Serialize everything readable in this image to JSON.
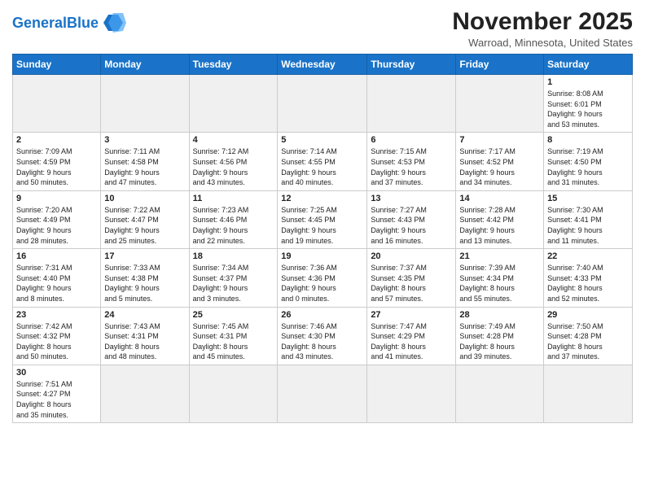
{
  "header": {
    "logo_general": "General",
    "logo_blue": "Blue",
    "month_year": "November 2025",
    "location": "Warroad, Minnesota, United States"
  },
  "days_of_week": [
    "Sunday",
    "Monday",
    "Tuesday",
    "Wednesday",
    "Thursday",
    "Friday",
    "Saturday"
  ],
  "weeks": [
    [
      {
        "day": "",
        "info": "",
        "empty": true
      },
      {
        "day": "",
        "info": "",
        "empty": true
      },
      {
        "day": "",
        "info": "",
        "empty": true
      },
      {
        "day": "",
        "info": "",
        "empty": true
      },
      {
        "day": "",
        "info": "",
        "empty": true
      },
      {
        "day": "",
        "info": "",
        "empty": true
      },
      {
        "day": "1",
        "info": "Sunrise: 8:08 AM\nSunset: 6:01 PM\nDaylight: 9 hours\nand 53 minutes."
      }
    ],
    [
      {
        "day": "2",
        "info": "Sunrise: 7:09 AM\nSunset: 4:59 PM\nDaylight: 9 hours\nand 50 minutes."
      },
      {
        "day": "3",
        "info": "Sunrise: 7:11 AM\nSunset: 4:58 PM\nDaylight: 9 hours\nand 47 minutes."
      },
      {
        "day": "4",
        "info": "Sunrise: 7:12 AM\nSunset: 4:56 PM\nDaylight: 9 hours\nand 43 minutes."
      },
      {
        "day": "5",
        "info": "Sunrise: 7:14 AM\nSunset: 4:55 PM\nDaylight: 9 hours\nand 40 minutes."
      },
      {
        "day": "6",
        "info": "Sunrise: 7:15 AM\nSunset: 4:53 PM\nDaylight: 9 hours\nand 37 minutes."
      },
      {
        "day": "7",
        "info": "Sunrise: 7:17 AM\nSunset: 4:52 PM\nDaylight: 9 hours\nand 34 minutes."
      },
      {
        "day": "8",
        "info": "Sunrise: 7:19 AM\nSunset: 4:50 PM\nDaylight: 9 hours\nand 31 minutes."
      }
    ],
    [
      {
        "day": "9",
        "info": "Sunrise: 7:20 AM\nSunset: 4:49 PM\nDaylight: 9 hours\nand 28 minutes."
      },
      {
        "day": "10",
        "info": "Sunrise: 7:22 AM\nSunset: 4:47 PM\nDaylight: 9 hours\nand 25 minutes."
      },
      {
        "day": "11",
        "info": "Sunrise: 7:23 AM\nSunset: 4:46 PM\nDaylight: 9 hours\nand 22 minutes."
      },
      {
        "day": "12",
        "info": "Sunrise: 7:25 AM\nSunset: 4:45 PM\nDaylight: 9 hours\nand 19 minutes."
      },
      {
        "day": "13",
        "info": "Sunrise: 7:27 AM\nSunset: 4:43 PM\nDaylight: 9 hours\nand 16 minutes."
      },
      {
        "day": "14",
        "info": "Sunrise: 7:28 AM\nSunset: 4:42 PM\nDaylight: 9 hours\nand 13 minutes."
      },
      {
        "day": "15",
        "info": "Sunrise: 7:30 AM\nSunset: 4:41 PM\nDaylight: 9 hours\nand 11 minutes."
      }
    ],
    [
      {
        "day": "16",
        "info": "Sunrise: 7:31 AM\nSunset: 4:40 PM\nDaylight: 9 hours\nand 8 minutes."
      },
      {
        "day": "17",
        "info": "Sunrise: 7:33 AM\nSunset: 4:38 PM\nDaylight: 9 hours\nand 5 minutes."
      },
      {
        "day": "18",
        "info": "Sunrise: 7:34 AM\nSunset: 4:37 PM\nDaylight: 9 hours\nand 3 minutes."
      },
      {
        "day": "19",
        "info": "Sunrise: 7:36 AM\nSunset: 4:36 PM\nDaylight: 9 hours\nand 0 minutes."
      },
      {
        "day": "20",
        "info": "Sunrise: 7:37 AM\nSunset: 4:35 PM\nDaylight: 8 hours\nand 57 minutes."
      },
      {
        "day": "21",
        "info": "Sunrise: 7:39 AM\nSunset: 4:34 PM\nDaylight: 8 hours\nand 55 minutes."
      },
      {
        "day": "22",
        "info": "Sunrise: 7:40 AM\nSunset: 4:33 PM\nDaylight: 8 hours\nand 52 minutes."
      }
    ],
    [
      {
        "day": "23",
        "info": "Sunrise: 7:42 AM\nSunset: 4:32 PM\nDaylight: 8 hours\nand 50 minutes."
      },
      {
        "day": "24",
        "info": "Sunrise: 7:43 AM\nSunset: 4:31 PM\nDaylight: 8 hours\nand 48 minutes."
      },
      {
        "day": "25",
        "info": "Sunrise: 7:45 AM\nSunset: 4:31 PM\nDaylight: 8 hours\nand 45 minutes."
      },
      {
        "day": "26",
        "info": "Sunrise: 7:46 AM\nSunset: 4:30 PM\nDaylight: 8 hours\nand 43 minutes."
      },
      {
        "day": "27",
        "info": "Sunrise: 7:47 AM\nSunset: 4:29 PM\nDaylight: 8 hours\nand 41 minutes."
      },
      {
        "day": "28",
        "info": "Sunrise: 7:49 AM\nSunset: 4:28 PM\nDaylight: 8 hours\nand 39 minutes."
      },
      {
        "day": "29",
        "info": "Sunrise: 7:50 AM\nSunset: 4:28 PM\nDaylight: 8 hours\nand 37 minutes."
      }
    ],
    [
      {
        "day": "30",
        "info": "Sunrise: 7:51 AM\nSunset: 4:27 PM\nDaylight: 8 hours\nand 35 minutes."
      },
      {
        "day": "",
        "info": "",
        "empty": true
      },
      {
        "day": "",
        "info": "",
        "empty": true
      },
      {
        "day": "",
        "info": "",
        "empty": true
      },
      {
        "day": "",
        "info": "",
        "empty": true
      },
      {
        "day": "",
        "info": "",
        "empty": true
      },
      {
        "day": "",
        "info": "",
        "empty": true
      }
    ]
  ]
}
